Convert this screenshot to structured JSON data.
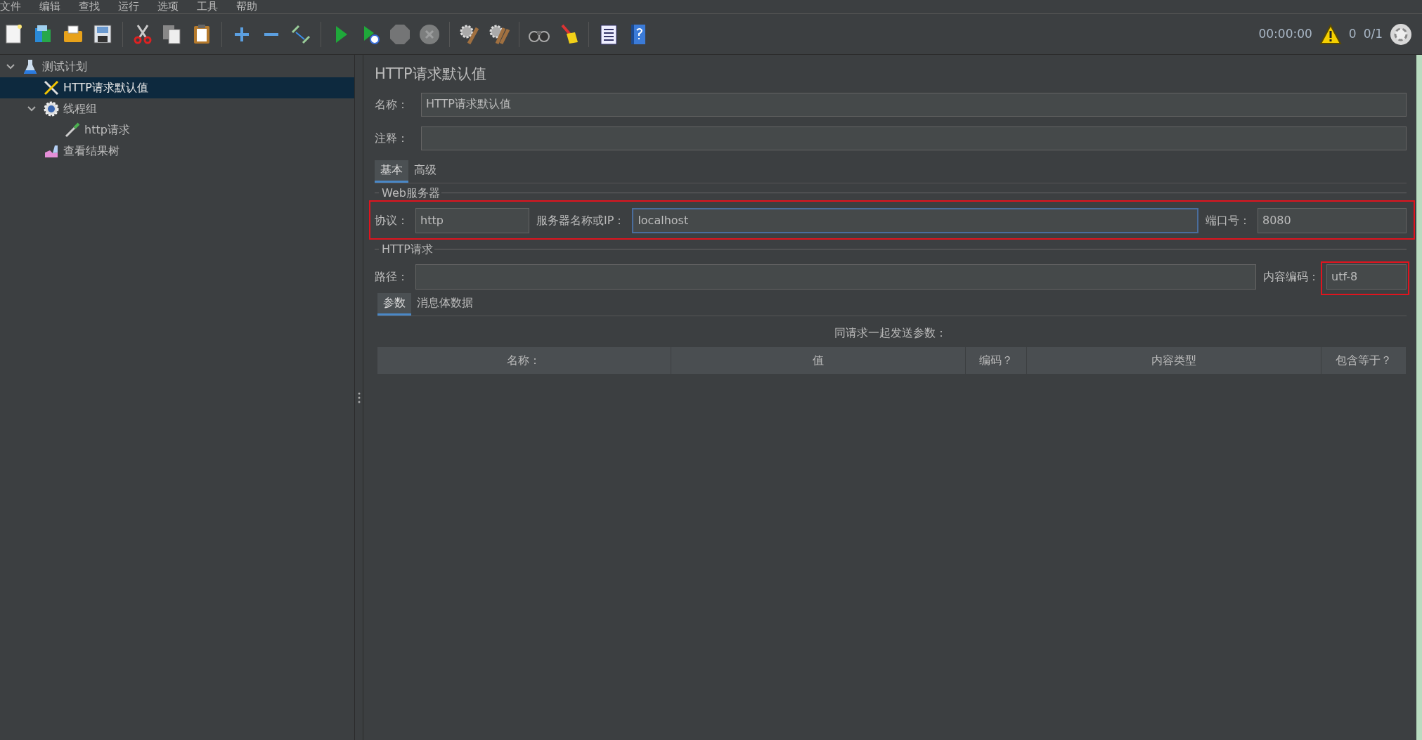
{
  "menu": [
    "文件",
    "编辑",
    "查找",
    "运行",
    "选项",
    "工具",
    "帮助"
  ],
  "toolbar": [
    [
      {
        "kind": "new",
        "disabled": false
      },
      {
        "kind": "templates",
        "disabled": false
      },
      {
        "kind": "open",
        "disabled": false
      },
      {
        "kind": "save",
        "disabled": false
      }
    ],
    [
      {
        "kind": "cut",
        "disabled": false
      },
      {
        "kind": "copy",
        "disabled": false
      },
      {
        "kind": "paste",
        "disabled": false
      }
    ],
    [
      {
        "kind": "add",
        "disabled": false
      },
      {
        "kind": "remove",
        "disabled": false
      },
      {
        "kind": "toggle",
        "disabled": false
      }
    ],
    [
      {
        "kind": "start",
        "disabled": false
      },
      {
        "kind": "start_no_pause",
        "disabled": false
      },
      {
        "kind": "stop",
        "disabled": true
      },
      {
        "kind": "shutdown",
        "disabled": true
      }
    ],
    [
      {
        "kind": "clear",
        "disabled": false
      },
      {
        "kind": "clear_all",
        "disabled": false
      }
    ],
    [
      {
        "kind": "search",
        "disabled": false
      },
      {
        "kind": "reset_search",
        "disabled": false
      }
    ],
    [
      {
        "kind": "functions",
        "disabled": false
      },
      {
        "kind": "help",
        "disabled": false
      }
    ]
  ],
  "status": {
    "timer": "00:00:00",
    "warnings": "0",
    "threads": "0/1"
  },
  "tree": [
    {
      "label": "测试计划",
      "kind": "plan",
      "expanded": true,
      "selected": false,
      "children": [
        {
          "label": "HTTP请求默认值",
          "kind": "config",
          "selected": true
        },
        {
          "label": "线程组",
          "kind": "threads",
          "expanded": true,
          "selected": false,
          "children": [
            {
              "label": "http请求",
              "kind": "sampler",
              "selected": false
            }
          ]
        },
        {
          "label": "查看结果树",
          "kind": "listener",
          "selected": false
        }
      ]
    }
  ],
  "panel": {
    "title": "HTTP请求默认值",
    "name": {
      "label": "名称：",
      "value": "HTTP请求默认值"
    },
    "comment": {
      "label": "注释："
    },
    "tabs": [
      {
        "label": "基本",
        "selected": true
      },
      {
        "label": "高级",
        "selected": false
      }
    ],
    "web_server": {
      "legend": "Web服务器",
      "protocol": {
        "label": "协议：",
        "value": "http"
      },
      "server": {
        "label": "服务器名称或IP：",
        "value": "localhost",
        "focused": true
      },
      "port": {
        "label": "端口号：",
        "value": "8080"
      }
    },
    "http_request": {
      "legend": "HTTP请求",
      "path": {
        "label": "路径："
      },
      "encoding": {
        "label": "内容编码：",
        "value": "utf-8"
      }
    },
    "sub_tabs": [
      {
        "label": "参数",
        "selected": true
      },
      {
        "label": "消息体数据",
        "selected": false
      }
    ],
    "params_title": "同请求一起发送参数：",
    "columns": [
      "名称：",
      "值",
      "编码？",
      "内容类型",
      "包含等于？"
    ]
  }
}
